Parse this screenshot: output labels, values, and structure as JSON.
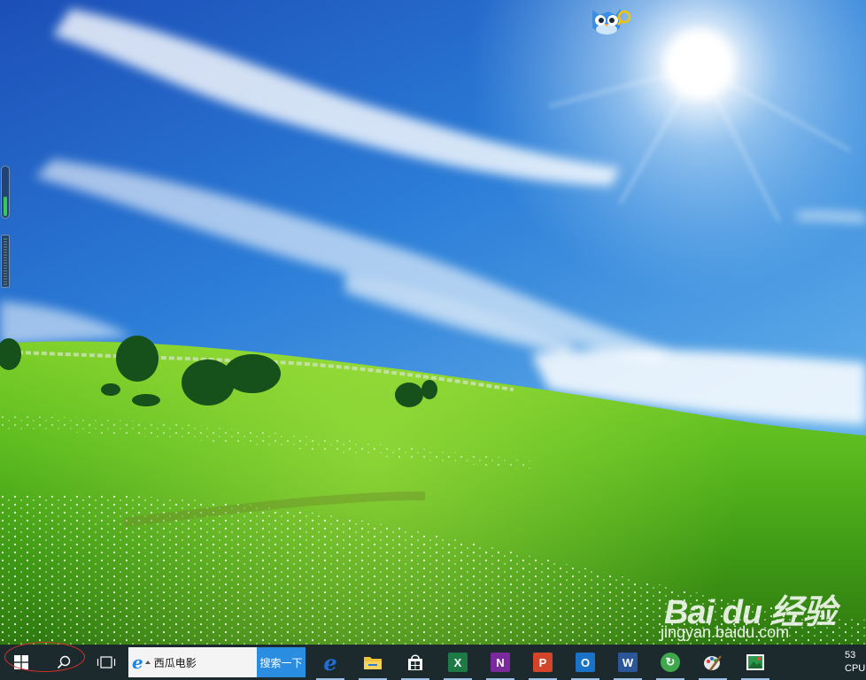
{
  "taskbar": {
    "start_label": "Start",
    "search_label": "Search",
    "taskview_label": "Task View",
    "search_box": {
      "text": "西瓜电影",
      "button_label": "搜索一下"
    },
    "apps": [
      {
        "name": "edge",
        "glyph": "e",
        "color": "#1f6fd6"
      },
      {
        "name": "file-explorer",
        "glyph": "",
        "color": "#f0c23a"
      },
      {
        "name": "store",
        "glyph": "",
        "color": "#ffffff"
      },
      {
        "name": "excel",
        "glyph": "X",
        "color": "#1d7a45"
      },
      {
        "name": "onenote",
        "glyph": "N",
        "color": "#7b2a9e"
      },
      {
        "name": "powerpoint",
        "glyph": "P",
        "color": "#d2452a"
      },
      {
        "name": "outlook",
        "glyph": "O",
        "color": "#1a73c8"
      },
      {
        "name": "word",
        "glyph": "W",
        "color": "#2b579a"
      },
      {
        "name": "refresh-app",
        "glyph": "↻",
        "color": "#3fa84a"
      },
      {
        "name": "paint",
        "glyph": "",
        "color": "#d8d8d8"
      },
      {
        "name": "photos",
        "glyph": "",
        "color": "#2a9a4a"
      }
    ],
    "clock": {
      "line1": "53",
      "line2": "CPU"
    }
  },
  "widgets": {
    "meter_top_level": 0.4,
    "meter_bottom_level": 0.95
  },
  "watermark": {
    "logo": "Bai du 经验",
    "url": "jingyan.baidu.com"
  },
  "colors": {
    "taskbar": "#1c2a2d",
    "search_button": "#2b8de0",
    "annotation": "#d8312a"
  }
}
